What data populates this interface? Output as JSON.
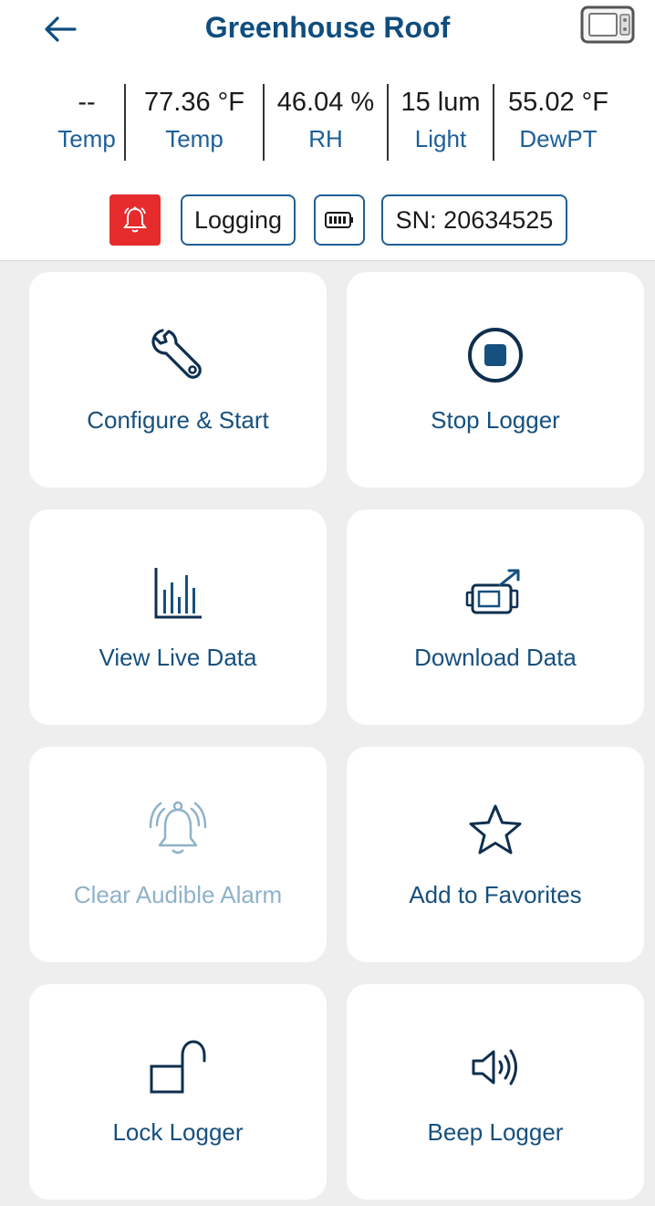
{
  "header": {
    "title": "Greenhouse Roof",
    "back_icon": "arrow-left-icon",
    "device_icon": "logger-device-icon"
  },
  "readings": [
    {
      "value": "--",
      "label": "Temp"
    },
    {
      "value": "77.36 °F",
      "label": "Temp"
    },
    {
      "value": "46.04 %",
      "label": "RH"
    },
    {
      "value": "15 lum",
      "label": "Light"
    },
    {
      "value": "55.02 °F",
      "label": "DewPT"
    }
  ],
  "status": {
    "alarm_icon": "bell-alarm-icon",
    "logging_label": "Logging",
    "battery_icon": "battery-icon",
    "serial_label": "SN: 20634525"
  },
  "tiles": [
    {
      "label": "Configure & Start",
      "icon": "wrench-icon",
      "enabled": true
    },
    {
      "label": "Stop Logger",
      "icon": "stop-circle-icon",
      "enabled": true
    },
    {
      "label": "View Live Data",
      "icon": "bar-chart-icon",
      "enabled": true
    },
    {
      "label": "Download Data",
      "icon": "download-device-icon",
      "enabled": true
    },
    {
      "label": "Clear Audible Alarm",
      "icon": "ringing-bell-icon",
      "enabled": false
    },
    {
      "label": "Add to Favorites",
      "icon": "star-icon",
      "enabled": true
    },
    {
      "label": "Lock Logger",
      "icon": "unlocked-padlock-icon",
      "enabled": true
    },
    {
      "label": "Beep Logger",
      "icon": "speaker-icon",
      "enabled": true
    }
  ],
  "colors": {
    "title": "#0f4d7e",
    "accent": "#16507f",
    "alarm": "#e52b2b",
    "disabled": "#8fb2c9",
    "grid_background": "#eeeeee"
  }
}
